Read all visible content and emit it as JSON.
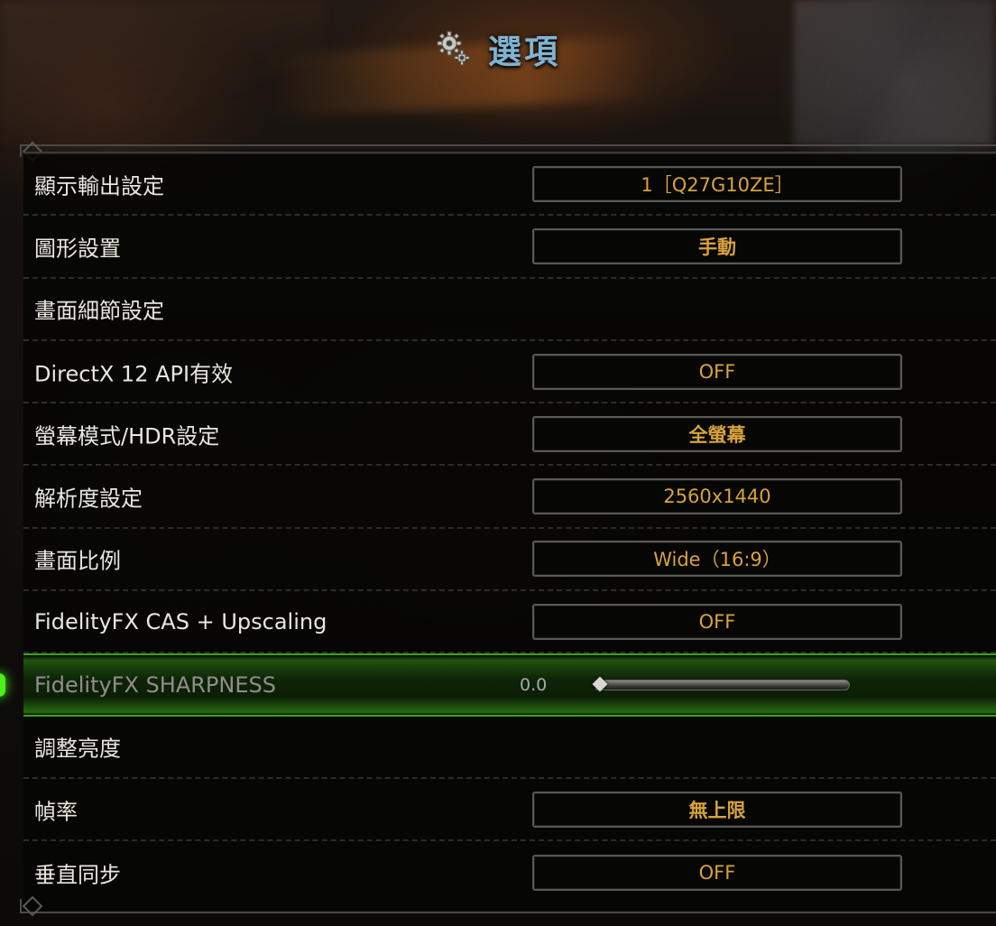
{
  "header": {
    "title": "選項",
    "icon": "gear-icon"
  },
  "colors": {
    "title": "#7fb3d3",
    "value_text": "#d8a33a",
    "label_text": "#e9e6de",
    "highlight": "#4df01c"
  },
  "settings": [
    {
      "label": "顯示輸出設定",
      "value": "1［Q27G10ZE］"
    },
    {
      "label": "圖形設置",
      "value": "手動"
    },
    {
      "label": "畫面細節設定",
      "value": null
    },
    {
      "label": "DirectX 12 API有效",
      "value": "OFF"
    },
    {
      "label": "螢幕模式/HDR設定",
      "value": "全螢幕"
    },
    {
      "label": "解析度設定",
      "value": "2560x1440"
    },
    {
      "label": "畫面比例",
      "value": "Wide（16:9）"
    },
    {
      "label": "FidelityFX CAS + Upscaling",
      "value": "OFF"
    },
    {
      "label": "FidelityFX SHARPNESS",
      "slider_value": "0.0",
      "slider_fraction": 0.0
    },
    {
      "label": "調整亮度",
      "value": null
    },
    {
      "label": "幀率",
      "value": "無上限"
    },
    {
      "label": "垂直同步",
      "value": "OFF"
    }
  ]
}
